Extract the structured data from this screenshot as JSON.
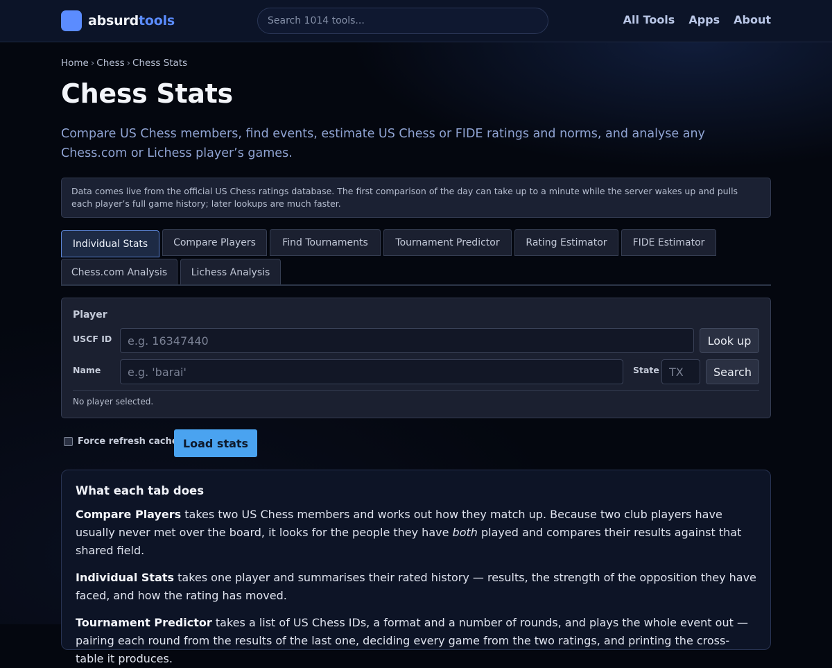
{
  "header": {
    "logo_part1": "absurd",
    "logo_part2": "tools",
    "search_placeholder": "Search 1014 tools...",
    "nav": [
      "All Tools",
      "Apps",
      "About"
    ]
  },
  "breadcrumb": [
    "Home",
    "Chess",
    "Chess Stats"
  ],
  "page": {
    "title": "Chess Stats",
    "lead": "Compare US Chess members, find events, estimate US Chess or FIDE ratings and norms, and analyse any Chess.com or Lichess player’s games.",
    "notice": "Data comes live from the official US Chess ratings database. The first comparison of the day can take up to a minute while the server wakes up and pulls each player’s full game history; later lookups are much faster."
  },
  "tabs": [
    "Individual Stats",
    "Compare Players",
    "Find Tournaments",
    "Tournament Predictor",
    "Rating Estimator",
    "FIDE Estimator",
    "Chess.com Analysis",
    "Lichess Analysis"
  ],
  "active_tab": "Individual Stats",
  "player_panel": {
    "title": "Player",
    "uscf_label": "USCF ID",
    "uscf_placeholder": "e.g. 16347440",
    "lookup_label": "Look up",
    "name_label": "Name",
    "name_placeholder": "e.g. 'barai'",
    "state_label": "State",
    "state_placeholder": "TX",
    "search_label": "Search",
    "status": "No player selected."
  },
  "actions": {
    "force_refresh_label": "Force refresh cache",
    "force_refresh_checked": false,
    "load_label": "Load stats"
  },
  "info": {
    "heading": "What each tab does",
    "items": [
      {
        "name": "Compare Players",
        "text_before": " takes two US Chess members and works out how they match up. Because two club players have usually never met over the board, it looks for the people they have ",
        "emphasis": "both",
        "text_after": " played and compares their results against that shared field."
      },
      {
        "name": "Individual Stats",
        "text": " takes one player and summarises their rated history — results, the strength of the opposition they have faced, and how the rating has moved."
      },
      {
        "name": "Tournament Predictor",
        "text": " takes a list of US Chess IDs, a format and a number of rounds, and plays the whole event out — pairing each round from the results of the last one, deciding every game from the two ratings, and printing the cross-table it produces."
      }
    ]
  },
  "colors": {
    "accent": "#5b8cff",
    "primary_button": "#4aa3f0",
    "background": "#04070f",
    "panel": "#1b2030"
  }
}
